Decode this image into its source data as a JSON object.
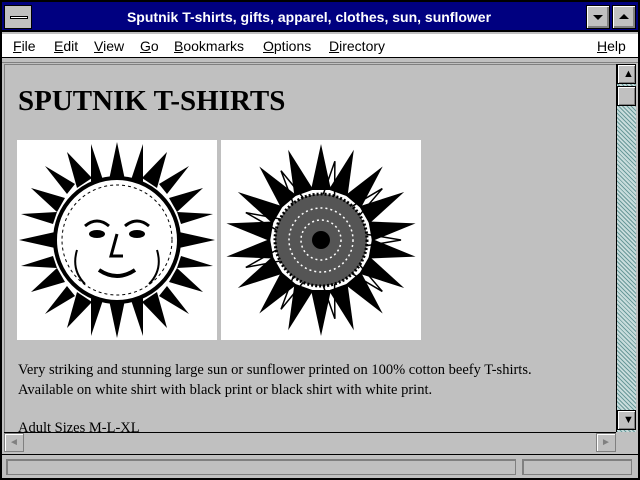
{
  "window": {
    "title": "Sputnik T-shirts, gifts, apparel, clothes, sun, sunflower"
  },
  "menubar": {
    "items": [
      {
        "first": "F",
        "rest": "ile"
      },
      {
        "first": "E",
        "rest": "dit"
      },
      {
        "first": "V",
        "rest": "iew"
      },
      {
        "first": "G",
        "rest": "o"
      },
      {
        "first": "B",
        "rest": "ookmarks"
      },
      {
        "first": "O",
        "rest": "ptions"
      },
      {
        "first": "D",
        "rest": "irectory"
      },
      {
        "first": "H",
        "rest": "elp"
      }
    ]
  },
  "page": {
    "heading": "SPUTNIK T-SHIRTS",
    "images": [
      {
        "icon": "sun-face-illustration"
      },
      {
        "icon": "sunflower-illustration"
      }
    ],
    "description_line1": "Very striking and stunning large sun or sunflower printed on 100% cotton beefy T-shirts.",
    "description_line2": "Available on white shirt with black print or black shirt with white print.",
    "sizes": "Adult Sizes M-L-XL"
  },
  "scrollbars": {
    "up_arrow": "▲",
    "down_arrow": "▼",
    "left_arrow": "◄",
    "right_arrow": "►"
  },
  "colors": {
    "titlebar": "#000080",
    "chrome": "#c0c0c0",
    "scroll_track": "#6a9a9a"
  }
}
